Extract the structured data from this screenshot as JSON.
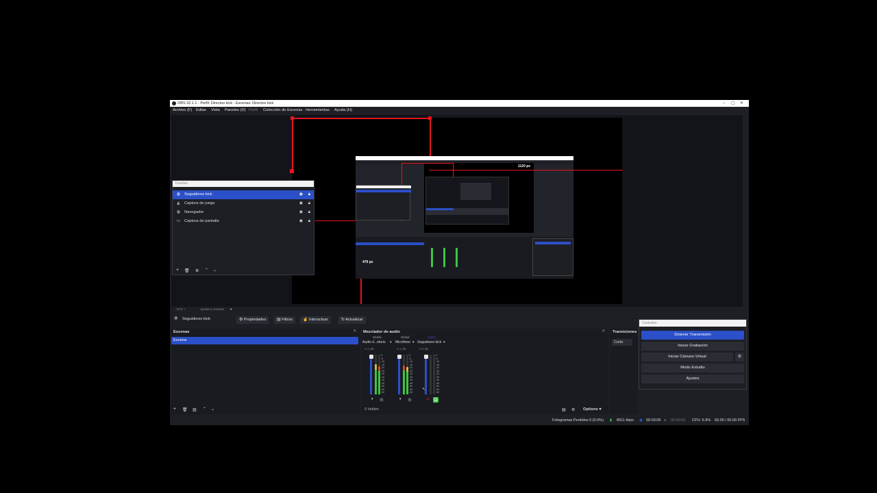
{
  "window": {
    "title": "OBS 32.1.1 - Perfil: Directos kick - Escenas: Directos kick"
  },
  "menu": {
    "items": [
      "Archivo (F)",
      "Editar",
      "Vista",
      "Paneles (D)",
      "Perfil",
      "Colección de Escenas",
      "Herramientas",
      "Ayuda (H)"
    ]
  },
  "preview": {
    "width_label": "1120 px",
    "height_label": "479 px",
    "zoom": "- 57% +",
    "fit_label": "Ajustar a ventana"
  },
  "sources": {
    "title": "Fuentes",
    "items": [
      {
        "label": "Seguidores kick",
        "selected": true,
        "icon": "globe-icon"
      },
      {
        "label": "Captura de juego",
        "selected": false,
        "icon": "gamepad-icon"
      },
      {
        "label": "Navegador",
        "selected": false,
        "icon": "globe-icon"
      },
      {
        "label": "Captura de pantalla",
        "selected": false,
        "icon": "monitor-icon"
      }
    ]
  },
  "source_toolbar": {
    "selected_source": "Seguidores kick",
    "properties": "Propiedades",
    "filters": "Filtros",
    "interact": "Interactuar",
    "refresh": "Actualizar"
  },
  "scenes": {
    "title": "Escenas",
    "items": [
      "Escena"
    ]
  },
  "mixer": {
    "title": "Mezclador de audio",
    "channels": [
      {
        "tag": "Global",
        "name": "Audio d...ritorio",
        "db": "-4.1 dB",
        "level": 0.62
      },
      {
        "tag": "Global",
        "name": "Micrófono",
        "db": "-4.1 dB",
        "level": 0.58
      },
      {
        "tag": "Activo",
        "name": "Seguidores kick",
        "db": "0.0 dB",
        "level": 0.0
      }
    ],
    "scale": [
      "0",
      "-5",
      "-10",
      "-15",
      "-20",
      "-25",
      "-30",
      "-35",
      "-40",
      "-45",
      "-50",
      "-55",
      "-60"
    ],
    "hidden": "0 hidden",
    "options": "Options"
  },
  "transitions": {
    "title": "Transiciones",
    "current": "Corte"
  },
  "controls": {
    "title": "Controles",
    "stop_stream": "Detener Transmisión",
    "start_recording": "Iniciar Grabación",
    "virtual_cam": "Iniciar Cámara Virtual",
    "studio_mode": "Modo Estudio",
    "settings": "Ajustes"
  },
  "status": {
    "dropped": "Fotogramas Perdidos 0 (0.0%)",
    "bitrate": "8911 kbps",
    "stream_time": "00:03:06",
    "rec_time": "00:00:00",
    "cpu": "CPU: 6.9%",
    "fps": "60.00 / 60.00 FPS"
  },
  "colors": {
    "accent": "#2b50c9",
    "guide": "#e8141c",
    "meter_green": "#3ec63e"
  }
}
